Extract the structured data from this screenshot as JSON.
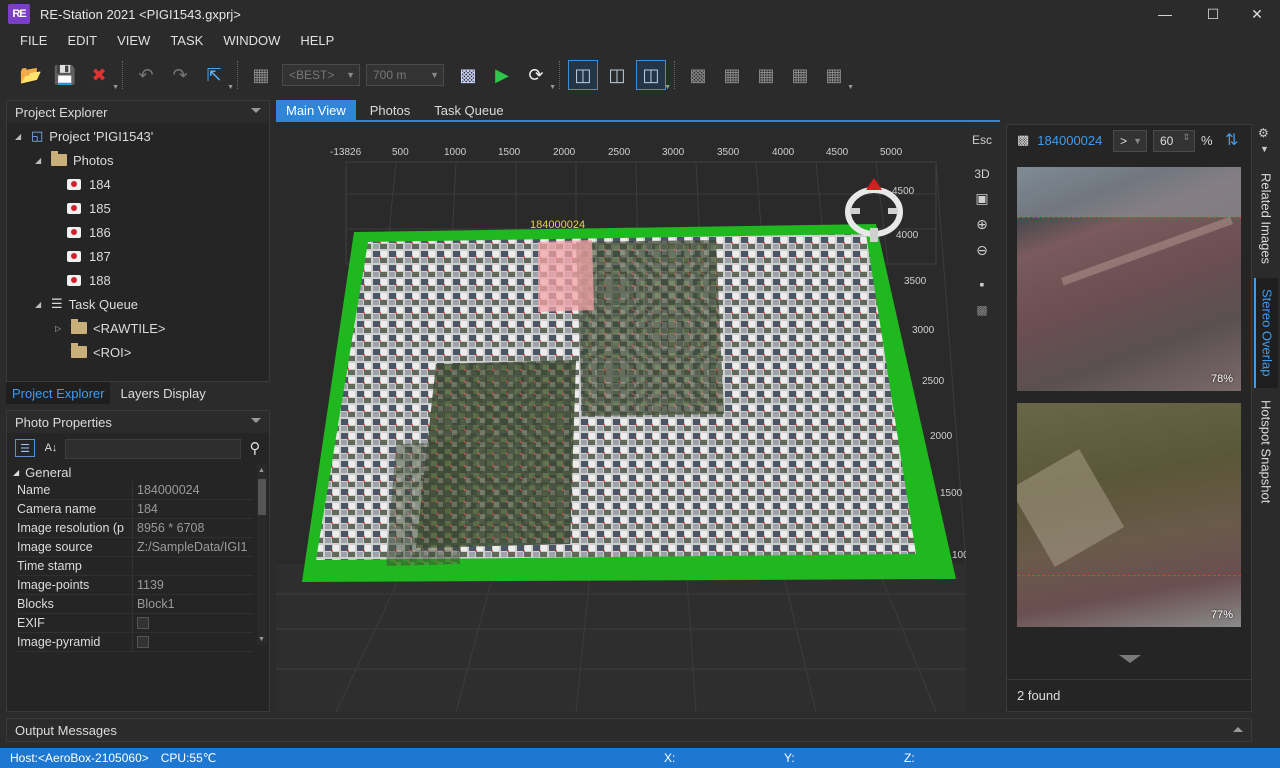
{
  "window": {
    "title": "RE-Station 2021  <PIGI1543.gxprj>",
    "logo": "RE"
  },
  "menu": [
    "FILE",
    "EDIT",
    "VIEW",
    "TASK",
    "WINDOW",
    "HELP"
  ],
  "toolbar": {
    "quality": "<BEST>",
    "distance": "700 m"
  },
  "project_explorer": {
    "title": "Project Explorer",
    "project": "Project 'PIGI1543'",
    "photos_label": "Photos",
    "photos": [
      "184",
      "185",
      "186",
      "187",
      "188"
    ],
    "task_queue_label": "Task Queue",
    "tasks": [
      "<RAWTILE>",
      "<ROI>"
    ]
  },
  "panel_tabs": [
    "Project Explorer",
    "Layers Display"
  ],
  "photo_properties": {
    "title": "Photo Properties",
    "group": "General",
    "rows": [
      {
        "k": "Name",
        "v": "184000024"
      },
      {
        "k": "Camera name",
        "v": "184"
      },
      {
        "k": "Image resolution (p",
        "v": "8956 * 6708"
      },
      {
        "k": "Image source",
        "v": "Z:/SampleData/IGI1"
      },
      {
        "k": "Time stamp",
        "v": ""
      },
      {
        "k": "Image-points",
        "v": "1139"
      },
      {
        "k": "Blocks",
        "v": "Block1"
      },
      {
        "k": "EXIF",
        "v": ""
      },
      {
        "k": "Image-pyramid",
        "v": ""
      }
    ]
  },
  "main_tabs": [
    "Main View",
    "Photos",
    "Task Queue"
  ],
  "view3d": {
    "x_ticks": [
      "-13826",
      "500",
      "1000",
      "1500",
      "2000",
      "2500",
      "3000",
      "3500",
      "4000",
      "4500",
      "5000"
    ],
    "y_ticks": [
      "4500",
      "4000",
      "3500",
      "3000",
      "2500",
      "2000",
      "1500",
      "100"
    ],
    "selected_label": "184000024"
  },
  "view_side": {
    "esc": "Esc",
    "three_d": "3D"
  },
  "right_panel": {
    "image_id": "184000024",
    "nav": ">",
    "zoom": "60",
    "zoom_unit": "%",
    "thumbs": [
      {
        "pct": "78%"
      },
      {
        "pct": "77%"
      }
    ],
    "found": "2 found"
  },
  "vertical_tabs": [
    "Related Images",
    "Stereo Overlap",
    "Hotspot Snapshot"
  ],
  "output": {
    "title": "Output Messages"
  },
  "status": {
    "host": "Host:<AeroBox-2105060>",
    "cpu": "CPU:55℃",
    "x": "X:",
    "y": "Y:",
    "z": "Z:"
  }
}
